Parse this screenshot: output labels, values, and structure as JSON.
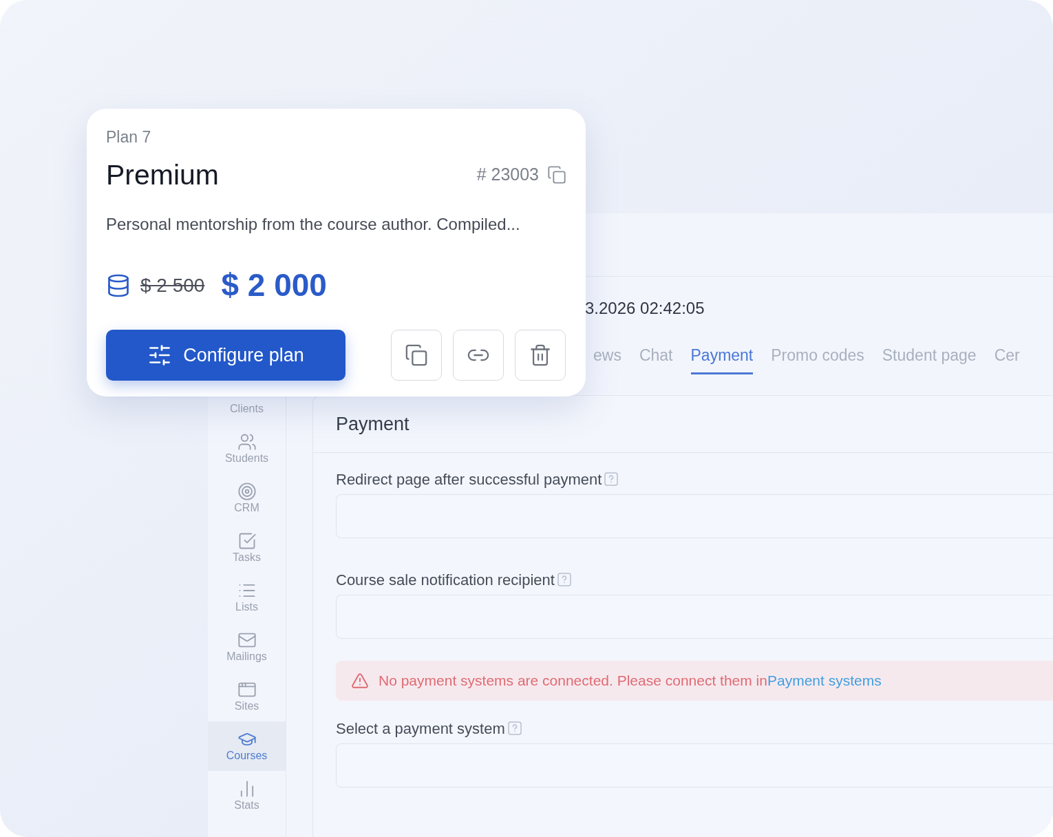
{
  "card": {
    "plan_label": "Plan 7",
    "title": "Premium",
    "id": "# 23003",
    "description": "Personal mentorship from the course author. Compiled...",
    "old_price": "$ 2 500",
    "price": "$ 2 000",
    "primary_button": "Configure plan"
  },
  "sidebar": {
    "items": [
      {
        "label": "Clients",
        "selected": false
      },
      {
        "label": "Students",
        "selected": false
      },
      {
        "label": "CRM",
        "selected": false
      },
      {
        "label": "Tasks",
        "selected": false
      },
      {
        "label": "Lists",
        "selected": false
      },
      {
        "label": "Mailings",
        "selected": false
      },
      {
        "label": "Sites",
        "selected": false
      },
      {
        "label": "Courses",
        "selected": true
      },
      {
        "label": "Stats",
        "selected": false
      }
    ]
  },
  "header": {
    "date": "3.2026 02:42:05"
  },
  "tabs": [
    {
      "label": "ews",
      "selected": false
    },
    {
      "label": "Chat",
      "selected": false
    },
    {
      "label": "Payment",
      "selected": true
    },
    {
      "label": "Promo codes",
      "selected": false
    },
    {
      "label": "Student page",
      "selected": false
    },
    {
      "label": "Cer",
      "selected": false
    }
  ],
  "payment": {
    "title": "Payment",
    "sections": [
      {
        "kind": "field",
        "label": "Redirect page after successful payment"
      },
      {
        "kind": "field",
        "label": "Course sale notification recipient"
      },
      {
        "kind": "alert",
        "text": "No payment systems are connected. Please connect them in",
        "link": "Payment systems"
      },
      {
        "kind": "field",
        "label": "Select a payment system"
      }
    ]
  }
}
